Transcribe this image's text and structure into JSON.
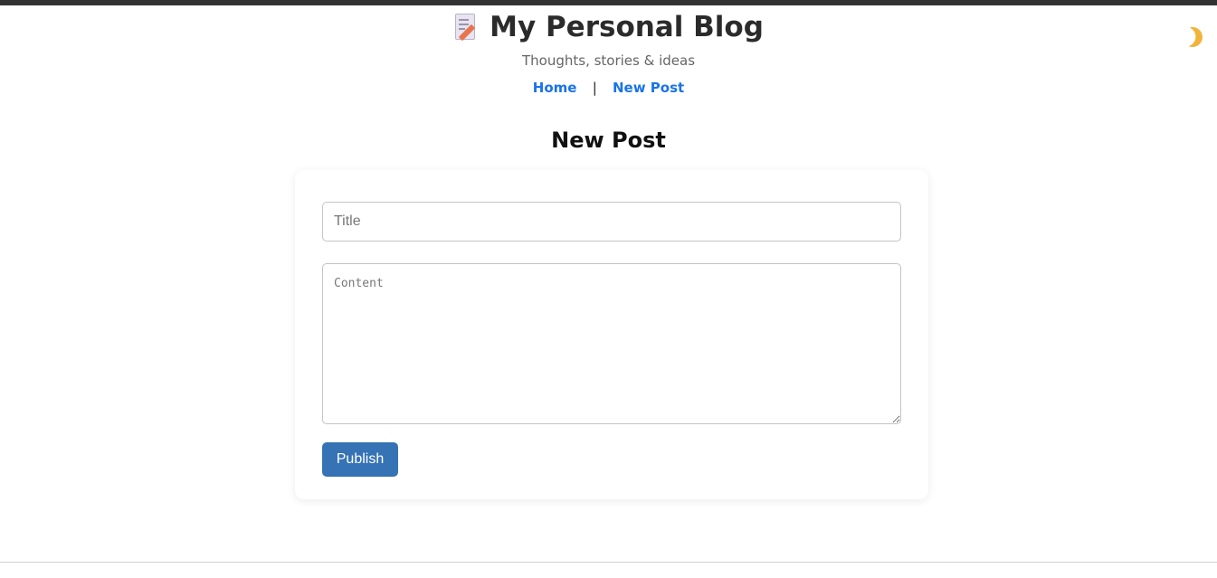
{
  "header": {
    "site_title": "My Personal Blog",
    "title_icon": "memo-icon",
    "subtitle": "Thoughts, stories & ideas",
    "nav": {
      "home_label": "Home",
      "separator": "|",
      "new_post_label": "New Post"
    },
    "theme_toggle_icon": "crescent-moon-icon"
  },
  "main": {
    "page_title": "New Post",
    "form": {
      "title_placeholder": "Title",
      "title_value": "",
      "content_placeholder": "Content",
      "content_value": "",
      "publish_label": "Publish"
    }
  },
  "colors": {
    "link": "#1a73e8",
    "publish_button": "#3673b5",
    "top_bar": "#333333",
    "moon": "#f2b33d"
  }
}
